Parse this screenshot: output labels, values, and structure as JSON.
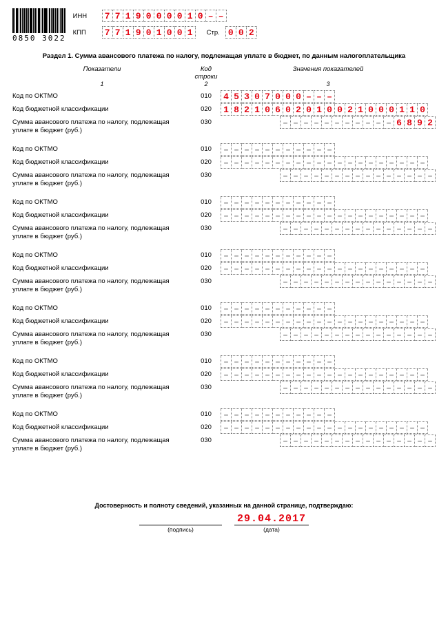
{
  "barcode": "0850 3022",
  "header": {
    "inn_label": "ИНН",
    "inn": "7719000010--",
    "kpp_label": "КПП",
    "kpp": "771901001",
    "page_label": "Стр.",
    "page": "002"
  },
  "section_title": "Раздел 1. Сумма авансового платежа по налогу, подлежащая уплате в бюджет, по данным налогоплательщика",
  "columns": {
    "c1": "Показатели",
    "c2": "Код строки",
    "c3": "Значения показателей",
    "n1": "1",
    "n2": "2",
    "n3": "3"
  },
  "row_labels": {
    "oktmo": "Код по ОКТМО",
    "kbk": "Код бюджетной классификации",
    "amount": "Сумма авансового платежа по налогу, подлежащая уплате в бюджет (руб.)"
  },
  "row_codes": {
    "oktmo": "010",
    "kbk": "020",
    "amount": "030"
  },
  "cell_counts": {
    "oktmo": 11,
    "kbk": 20,
    "amount": 15
  },
  "blocks": [
    {
      "oktmo": "45307000---",
      "kbk": "18210602010021000110",
      "amount": "6892"
    },
    {
      "oktmo": "",
      "kbk": "",
      "amount": ""
    },
    {
      "oktmo": "",
      "kbk": "",
      "amount": ""
    },
    {
      "oktmo": "",
      "kbk": "",
      "amount": ""
    },
    {
      "oktmo": "",
      "kbk": "",
      "amount": ""
    },
    {
      "oktmo": "",
      "kbk": "",
      "amount": ""
    },
    {
      "oktmo": "",
      "kbk": "",
      "amount": ""
    }
  ],
  "footer": {
    "attest": "Достоверность и полноту сведений, указанных на данной странице, подтверждаю:",
    "signature_caption": "(подпись)",
    "date_caption": "(дата)",
    "date": "29.04.2017"
  }
}
